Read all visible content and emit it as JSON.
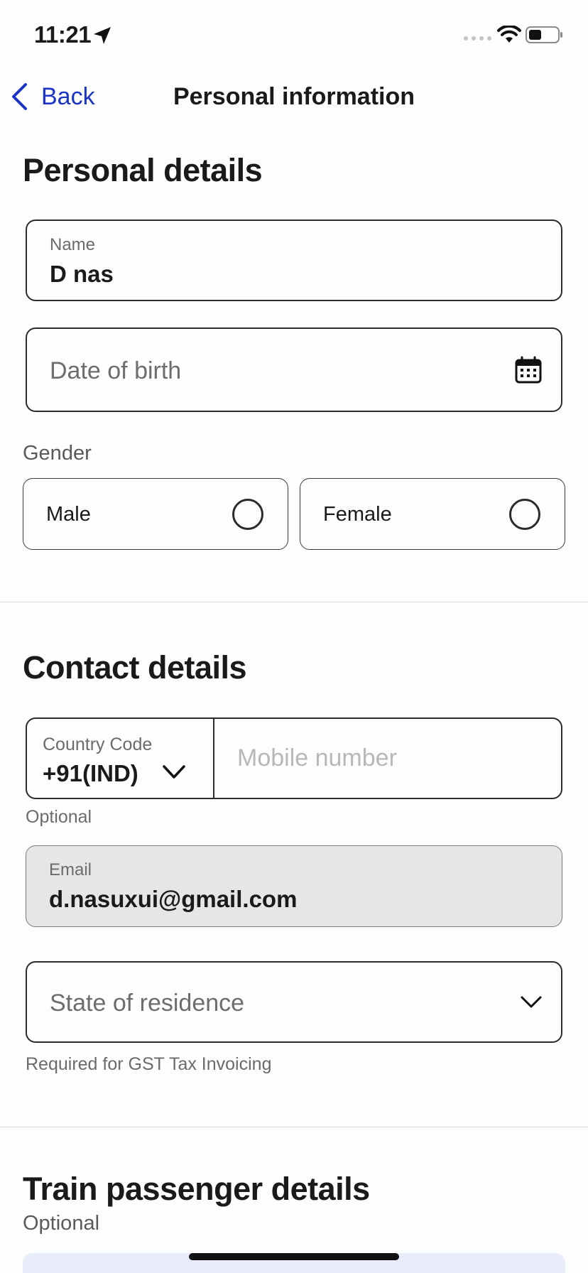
{
  "status_bar": {
    "time": "11:21",
    "icons": [
      "location-arrow-icon",
      "signal-dots-icon",
      "wifi-icon",
      "battery-icon"
    ]
  },
  "nav": {
    "back_label": "Back",
    "title": "Personal information"
  },
  "personal_details": {
    "title": "Personal details",
    "name": {
      "label": "Name",
      "value": "D nas"
    },
    "dob": {
      "placeholder": "Date of birth",
      "icon": "calendar-icon"
    },
    "gender": {
      "label": "Gender",
      "options": [
        {
          "label": "Male",
          "selected": false
        },
        {
          "label": "Female",
          "selected": false
        }
      ]
    }
  },
  "contact_details": {
    "title": "Contact details",
    "country_code": {
      "label": "Country Code",
      "value": "+91(IND)"
    },
    "mobile": {
      "placeholder": "Mobile number",
      "helper": "Optional"
    },
    "email": {
      "label": "Email",
      "value": "d.nasuxui@gmail.com"
    },
    "state": {
      "placeholder": "State of residence",
      "helper": "Required for GST Tax Invoicing"
    }
  },
  "train_passenger": {
    "title": "Train passenger details",
    "subtitle": "Optional"
  },
  "colors": {
    "accent": "#1a34c7",
    "border": "#2b2b2b",
    "disabled_bg": "#e6e6e6",
    "banner_bg": "#e8ecfb"
  }
}
